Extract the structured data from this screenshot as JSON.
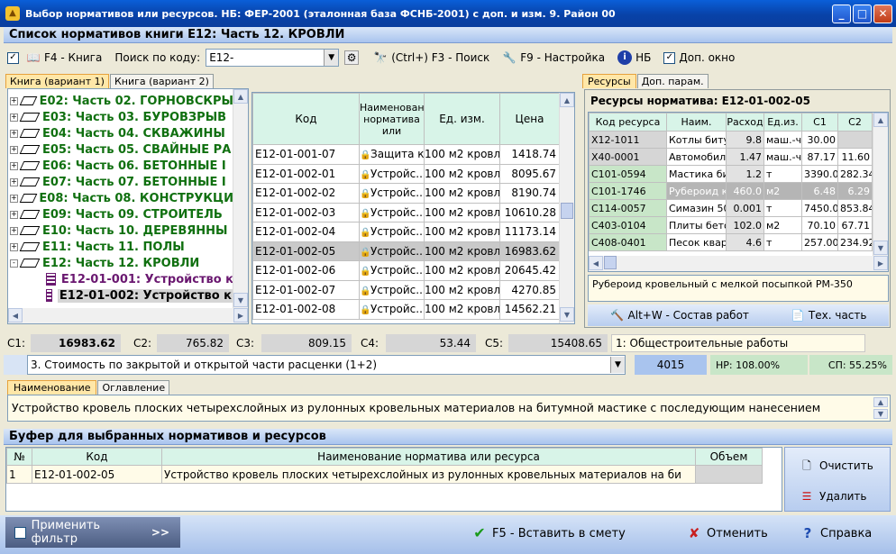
{
  "window": {
    "title": "Выбор нормативов или ресурсов. НБ: ФЕР-2001 (эталонная база ФСНБ-2001) с доп. и изм. 9. Район 00"
  },
  "list_title": "Список нормативов книги Е12: Часть 12. КРОВЛИ",
  "toolbar": {
    "book_label": "F4 - Книга",
    "search_code_label": "Поиск по коду:",
    "search_code_value": "E12-",
    "search_label": "(Ctrl+) F3 - Поиск",
    "settings_label": "F9 - Настройка",
    "nb_label": "НБ",
    "extra_window_label": "Доп. окно"
  },
  "book_tabs": [
    "Книга (вариант 1)",
    "Книга (вариант 2)"
  ],
  "tree": [
    {
      "label": "E02: Часть 02. ГОРНОВСКРЫ",
      "exp": "+"
    },
    {
      "label": "E03: Часть 03. БУРОВЗРЫВ",
      "exp": "+"
    },
    {
      "label": "E04: Часть 04. СКВАЖИНЫ",
      "exp": "+"
    },
    {
      "label": "E05: Часть 05. СВАЙНЫЕ РА",
      "exp": "+"
    },
    {
      "label": "E06: Часть 06. БЕТОННЫЕ I",
      "exp": "+"
    },
    {
      "label": "E07: Часть 07. БЕТОННЫЕ I",
      "exp": "+"
    },
    {
      "label": "E08: Часть 08. КОНСТРУКЦИ",
      "exp": "+"
    },
    {
      "label": "E09: Часть 09. СТРОИТЕЛЬ",
      "exp": "+"
    },
    {
      "label": "E10: Часть 10. ДЕРЕВЯННЫ",
      "exp": "+"
    },
    {
      "label": "E11: Часть 11. ПОЛЫ",
      "exp": "+"
    },
    {
      "label": "E12: Часть 12. КРОВЛИ",
      "exp": "-"
    }
  ],
  "tree_children": [
    {
      "label": "E12-01-001: Устройство к"
    },
    {
      "label": "E12-01-002: Устройство к"
    }
  ],
  "norms_table": {
    "headers": [
      "Код",
      "Наименование норматива или",
      "Ед. изм.",
      "Цена"
    ],
    "rows": [
      {
        "code": "E12-01-001-07",
        "name": "Защита к...",
        "unit": "100 м2 кровл",
        "price": "1418.74"
      },
      {
        "code": "E12-01-002-01",
        "name": "Устройс...",
        "unit": "100 м2 кровл",
        "price": "8095.67"
      },
      {
        "code": "E12-01-002-02",
        "name": "Устройс...",
        "unit": "100 м2 кровл",
        "price": "8190.74"
      },
      {
        "code": "E12-01-002-03",
        "name": "Устройс...",
        "unit": "100 м2 кровл",
        "price": "10610.28"
      },
      {
        "code": "E12-01-002-04",
        "name": "Устройс...",
        "unit": "100 м2 кровл",
        "price": "11173.14"
      },
      {
        "code": "E12-01-002-05",
        "name": "Устройс...",
        "unit": "100 м2 кровл",
        "price": "16983.62"
      },
      {
        "code": "E12-01-002-06",
        "name": "Устройс...",
        "unit": "100 м2 кровл",
        "price": "20645.42"
      },
      {
        "code": "E12-01-002-07",
        "name": "Устройс...",
        "unit": "100 м2 кровл",
        "price": "4270.85"
      },
      {
        "code": "E12-01-002-08",
        "name": "Устройс...",
        "unit": "100 м2 кровл",
        "price": "14562.21"
      }
    ]
  },
  "res_tabs": [
    "Ресурсы",
    "Доп. парам."
  ],
  "resources": {
    "title": "Ресурсы норматива: E12-01-002-05",
    "headers": [
      "Код ресурса",
      "Наим.",
      "Расход",
      "Ед.из.",
      "С1",
      "С2"
    ],
    "rows": [
      {
        "code": "X12-1011",
        "name": "Котлы битум",
        "qty": "9.8",
        "unit": "маш.-ч",
        "c1": "30.00",
        "c2": ""
      },
      {
        "code": "X40-0001",
        "name": "Автомобили",
        "qty": "1.47",
        "unit": "маш.-ч",
        "c1": "87.17",
        "c2": "11.60"
      },
      {
        "code": "C101-0594",
        "name": "Мастика бит",
        "qty": "1.2",
        "unit": "т",
        "c1": "3390.00",
        "c2": "282.34"
      },
      {
        "code": "C101-1746",
        "name": "Рубероид кр",
        "qty": "460.0",
        "unit": "м2",
        "c1": "6.48",
        "c2": "6.29"
      },
      {
        "code": "C114-0057",
        "name": "Симазин 50%",
        "qty": "0.001",
        "unit": "т",
        "c1": "7450.00",
        "c2": "853.84"
      },
      {
        "code": "C403-0104",
        "name": "Плиты бетон",
        "qty": "102.0",
        "unit": "м2",
        "c1": "70.10",
        "c2": "67.71"
      },
      {
        "code": "C408-0401",
        "name": "Песок кварц",
        "qty": "4.6",
        "unit": "т",
        "c1": "257.00",
        "c2": "234.92"
      }
    ],
    "description": "Рубероид кровельный с мелкой посыпкой РМ-350",
    "works_label": "Alt+W - Состав работ",
    "tech_label": "Тех. часть"
  },
  "stats": {
    "c1_label": "С1:",
    "c1": "16983.62",
    "c2_label": "С2:",
    "c2": "765.82",
    "c3_label": "С3:",
    "c3": "809.15",
    "c4_label": "С4:",
    "c4": "53.44",
    "c5_label": "С5:",
    "c5": "15408.65",
    "work_type": "1: Общестроительные работы",
    "price_variant": "3. Стоимость по закрытой и открытой части расценки (1+2)",
    "code_num": "4015",
    "nr": "НР: 108.00%",
    "sp": "СП: 55.25%"
  },
  "name_tabs": [
    "Наименование",
    "Оглавление"
  ],
  "full_name": "Устройство кровель плоских четырехслойных из рулонных кровельных материалов на битумной мастике с последующим нанесением",
  "buffer": {
    "title": "Буфер для выбранных нормативов и ресурсов",
    "headers": [
      "№",
      "Код",
      "Наименование норматива или ресурса",
      "Объем"
    ],
    "rows": [
      {
        "num": "1",
        "code": "E12-01-002-05",
        "name": "Устройство кровель плоских четырехслойных из рулонных кровельных материалов на би",
        "vol": ""
      }
    ],
    "clear_label": "Очистить",
    "delete_label": "Удалить"
  },
  "footer": {
    "filter_label": "Применить фильтр",
    "more_label": ">>",
    "insert_label": "F5 - Вставить в смету",
    "cancel_label": "Отменить",
    "help_label": "Справка"
  }
}
